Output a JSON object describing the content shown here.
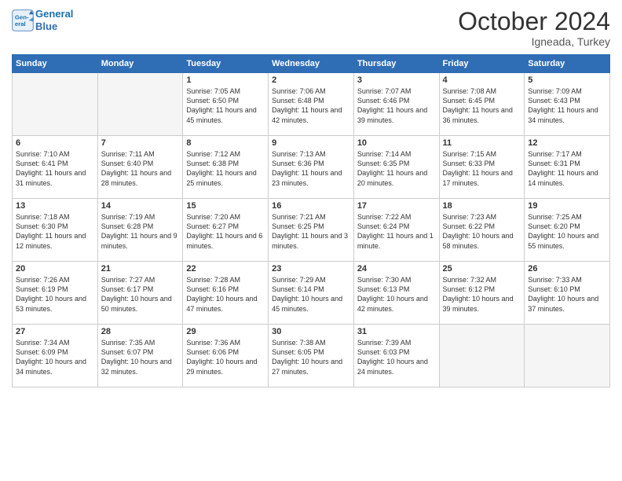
{
  "header": {
    "logo_line1": "General",
    "logo_line2": "Blue",
    "month": "October 2024",
    "location": "Igneada, Turkey"
  },
  "weekdays": [
    "Sunday",
    "Monday",
    "Tuesday",
    "Wednesday",
    "Thursday",
    "Friday",
    "Saturday"
  ],
  "weeks": [
    [
      {
        "day": "",
        "sunrise": "",
        "sunset": "",
        "daylight": "",
        "empty": true
      },
      {
        "day": "",
        "sunrise": "",
        "sunset": "",
        "daylight": "",
        "empty": true
      },
      {
        "day": "1",
        "sunrise": "Sunrise: 7:05 AM",
        "sunset": "Sunset: 6:50 PM",
        "daylight": "Daylight: 11 hours and 45 minutes.",
        "empty": false
      },
      {
        "day": "2",
        "sunrise": "Sunrise: 7:06 AM",
        "sunset": "Sunset: 6:48 PM",
        "daylight": "Daylight: 11 hours and 42 minutes.",
        "empty": false
      },
      {
        "day": "3",
        "sunrise": "Sunrise: 7:07 AM",
        "sunset": "Sunset: 6:46 PM",
        "daylight": "Daylight: 11 hours and 39 minutes.",
        "empty": false
      },
      {
        "day": "4",
        "sunrise": "Sunrise: 7:08 AM",
        "sunset": "Sunset: 6:45 PM",
        "daylight": "Daylight: 11 hours and 36 minutes.",
        "empty": false
      },
      {
        "day": "5",
        "sunrise": "Sunrise: 7:09 AM",
        "sunset": "Sunset: 6:43 PM",
        "daylight": "Daylight: 11 hours and 34 minutes.",
        "empty": false
      }
    ],
    [
      {
        "day": "6",
        "sunrise": "Sunrise: 7:10 AM",
        "sunset": "Sunset: 6:41 PM",
        "daylight": "Daylight: 11 hours and 31 minutes.",
        "empty": false
      },
      {
        "day": "7",
        "sunrise": "Sunrise: 7:11 AM",
        "sunset": "Sunset: 6:40 PM",
        "daylight": "Daylight: 11 hours and 28 minutes.",
        "empty": false
      },
      {
        "day": "8",
        "sunrise": "Sunrise: 7:12 AM",
        "sunset": "Sunset: 6:38 PM",
        "daylight": "Daylight: 11 hours and 25 minutes.",
        "empty": false
      },
      {
        "day": "9",
        "sunrise": "Sunrise: 7:13 AM",
        "sunset": "Sunset: 6:36 PM",
        "daylight": "Daylight: 11 hours and 23 minutes.",
        "empty": false
      },
      {
        "day": "10",
        "sunrise": "Sunrise: 7:14 AM",
        "sunset": "Sunset: 6:35 PM",
        "daylight": "Daylight: 11 hours and 20 minutes.",
        "empty": false
      },
      {
        "day": "11",
        "sunrise": "Sunrise: 7:15 AM",
        "sunset": "Sunset: 6:33 PM",
        "daylight": "Daylight: 11 hours and 17 minutes.",
        "empty": false
      },
      {
        "day": "12",
        "sunrise": "Sunrise: 7:17 AM",
        "sunset": "Sunset: 6:31 PM",
        "daylight": "Daylight: 11 hours and 14 minutes.",
        "empty": false
      }
    ],
    [
      {
        "day": "13",
        "sunrise": "Sunrise: 7:18 AM",
        "sunset": "Sunset: 6:30 PM",
        "daylight": "Daylight: 11 hours and 12 minutes.",
        "empty": false
      },
      {
        "day": "14",
        "sunrise": "Sunrise: 7:19 AM",
        "sunset": "Sunset: 6:28 PM",
        "daylight": "Daylight: 11 hours and 9 minutes.",
        "empty": false
      },
      {
        "day": "15",
        "sunrise": "Sunrise: 7:20 AM",
        "sunset": "Sunset: 6:27 PM",
        "daylight": "Daylight: 11 hours and 6 minutes.",
        "empty": false
      },
      {
        "day": "16",
        "sunrise": "Sunrise: 7:21 AM",
        "sunset": "Sunset: 6:25 PM",
        "daylight": "Daylight: 11 hours and 3 minutes.",
        "empty": false
      },
      {
        "day": "17",
        "sunrise": "Sunrise: 7:22 AM",
        "sunset": "Sunset: 6:24 PM",
        "daylight": "Daylight: 11 hours and 1 minute.",
        "empty": false
      },
      {
        "day": "18",
        "sunrise": "Sunrise: 7:23 AM",
        "sunset": "Sunset: 6:22 PM",
        "daylight": "Daylight: 10 hours and 58 minutes.",
        "empty": false
      },
      {
        "day": "19",
        "sunrise": "Sunrise: 7:25 AM",
        "sunset": "Sunset: 6:20 PM",
        "daylight": "Daylight: 10 hours and 55 minutes.",
        "empty": false
      }
    ],
    [
      {
        "day": "20",
        "sunrise": "Sunrise: 7:26 AM",
        "sunset": "Sunset: 6:19 PM",
        "daylight": "Daylight: 10 hours and 53 minutes.",
        "empty": false
      },
      {
        "day": "21",
        "sunrise": "Sunrise: 7:27 AM",
        "sunset": "Sunset: 6:17 PM",
        "daylight": "Daylight: 10 hours and 50 minutes.",
        "empty": false
      },
      {
        "day": "22",
        "sunrise": "Sunrise: 7:28 AM",
        "sunset": "Sunset: 6:16 PM",
        "daylight": "Daylight: 10 hours and 47 minutes.",
        "empty": false
      },
      {
        "day": "23",
        "sunrise": "Sunrise: 7:29 AM",
        "sunset": "Sunset: 6:14 PM",
        "daylight": "Daylight: 10 hours and 45 minutes.",
        "empty": false
      },
      {
        "day": "24",
        "sunrise": "Sunrise: 7:30 AM",
        "sunset": "Sunset: 6:13 PM",
        "daylight": "Daylight: 10 hours and 42 minutes.",
        "empty": false
      },
      {
        "day": "25",
        "sunrise": "Sunrise: 7:32 AM",
        "sunset": "Sunset: 6:12 PM",
        "daylight": "Daylight: 10 hours and 39 minutes.",
        "empty": false
      },
      {
        "day": "26",
        "sunrise": "Sunrise: 7:33 AM",
        "sunset": "Sunset: 6:10 PM",
        "daylight": "Daylight: 10 hours and 37 minutes.",
        "empty": false
      }
    ],
    [
      {
        "day": "27",
        "sunrise": "Sunrise: 7:34 AM",
        "sunset": "Sunset: 6:09 PM",
        "daylight": "Daylight: 10 hours and 34 minutes.",
        "empty": false
      },
      {
        "day": "28",
        "sunrise": "Sunrise: 7:35 AM",
        "sunset": "Sunset: 6:07 PM",
        "daylight": "Daylight: 10 hours and 32 minutes.",
        "empty": false
      },
      {
        "day": "29",
        "sunrise": "Sunrise: 7:36 AM",
        "sunset": "Sunset: 6:06 PM",
        "daylight": "Daylight: 10 hours and 29 minutes.",
        "empty": false
      },
      {
        "day": "30",
        "sunrise": "Sunrise: 7:38 AM",
        "sunset": "Sunset: 6:05 PM",
        "daylight": "Daylight: 10 hours and 27 minutes.",
        "empty": false
      },
      {
        "day": "31",
        "sunrise": "Sunrise: 7:39 AM",
        "sunset": "Sunset: 6:03 PM",
        "daylight": "Daylight: 10 hours and 24 minutes.",
        "empty": false
      },
      {
        "day": "",
        "sunrise": "",
        "sunset": "",
        "daylight": "",
        "empty": true
      },
      {
        "day": "",
        "sunrise": "",
        "sunset": "",
        "daylight": "",
        "empty": true
      }
    ]
  ]
}
